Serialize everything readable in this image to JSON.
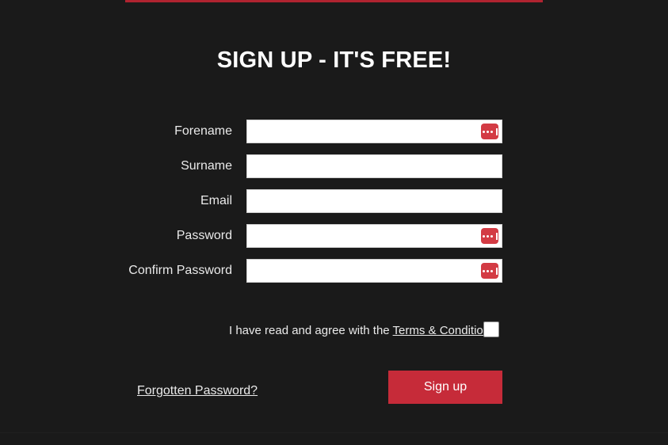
{
  "theme": {
    "background": "#1a1a1a",
    "accent_red": "#c62b39",
    "rule_red": "#b02330",
    "text": "#eaeaea",
    "field_background": "#ffffff"
  },
  "header": {
    "title": "SIGN UP - IT'S FREE!"
  },
  "form": {
    "fields": [
      {
        "label": "Forename",
        "value": "",
        "placeholder": "",
        "type": "text",
        "has_password_manager_icon": true,
        "icon_name": "password-manager-icon"
      },
      {
        "label": "Surname",
        "value": "",
        "placeholder": "",
        "type": "text",
        "has_password_manager_icon": false,
        "icon_name": ""
      },
      {
        "label": "Email",
        "value": "",
        "placeholder": "",
        "type": "text",
        "has_password_manager_icon": false,
        "icon_name": ""
      },
      {
        "label": "Password",
        "value": "",
        "placeholder": "",
        "type": "password",
        "has_password_manager_icon": true,
        "icon_name": "password-manager-icon"
      },
      {
        "label": "Confirm Password",
        "value": "",
        "placeholder": "",
        "type": "password",
        "has_password_manager_icon": true,
        "icon_name": "password-manager-icon"
      }
    ]
  },
  "terms": {
    "prefix": "I have read and agree with the ",
    "link_label": "Terms & Conditions",
    "checkbox_checked": false
  },
  "actions": {
    "forgot_password_label": "Forgotten Password?",
    "signup_label": "Sign up"
  }
}
